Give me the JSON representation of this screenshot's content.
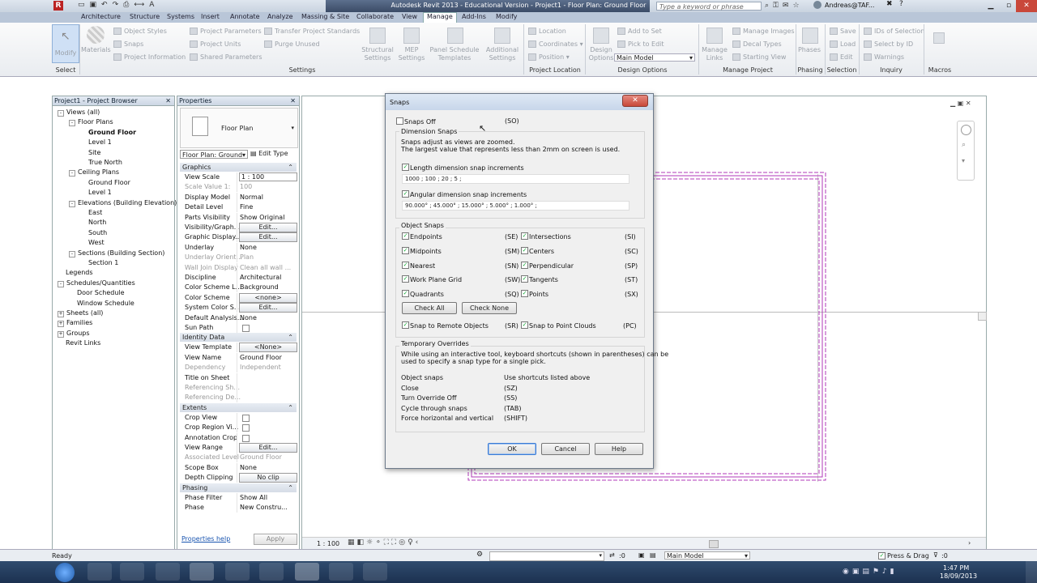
{
  "window": {
    "title": "Autodesk Revit 2013 - Educational Version  -  Project1 - Floor Plan: Ground Floor",
    "search_placeholder": "Type a keyword or phrase",
    "user": "Andreas@TAF..."
  },
  "tabs": [
    "Architecture",
    "Structure",
    "Systems",
    "Insert",
    "Annotate",
    "Analyze",
    "Massing & Site",
    "Collaborate",
    "View",
    "Manage",
    "Add-Ins",
    "Modify"
  ],
  "active_tab": "Manage",
  "ribbon": {
    "modify": "Modify",
    "materials": "Materials",
    "settings_items": [
      "Object Styles",
      "Snaps",
      "Project Information",
      "Project Parameters",
      "Project Units",
      "Shared Parameters",
      "Transfer Project Standards",
      "Purge Unused"
    ],
    "big_items": [
      "Structural Settings",
      "MEP Settings",
      "Panel Schedule Templates",
      "Additional Settings"
    ],
    "location_items": [
      "Location",
      "Coordinates",
      "Position"
    ],
    "design_options": "Design Options",
    "design_option_items": [
      "Add to Set",
      "Pick to Edit",
      "Main Model"
    ],
    "manage_links": "Manage Links",
    "manage_project_items": [
      "Manage Images",
      "Decal Types",
      "Starting View"
    ],
    "phases": "Phases",
    "selection_items": [
      "Save",
      "Load",
      "Edit"
    ],
    "inquiry_items": [
      "IDs of Selection",
      "Select by ID",
      "Warnings"
    ],
    "panel_labels": [
      "Select",
      "Settings",
      "Project Location",
      "Design Options",
      "Manage Project",
      "Phasing",
      "Selection",
      "Inquiry",
      "Macros"
    ]
  },
  "browser": {
    "title": "Project1 - Project Browser",
    "items": [
      {
        "label": "Views (all)",
        "indent": 0,
        "box": "-"
      },
      {
        "label": "Floor Plans",
        "indent": 1,
        "box": "-"
      },
      {
        "label": "Ground Floor",
        "indent": 2,
        "bold": true
      },
      {
        "label": "Level 1",
        "indent": 2
      },
      {
        "label": "Site",
        "indent": 2
      },
      {
        "label": "True North",
        "indent": 2
      },
      {
        "label": "Ceiling Plans",
        "indent": 1,
        "box": "-"
      },
      {
        "label": "Ground Floor",
        "indent": 2
      },
      {
        "label": "Level 1",
        "indent": 2
      },
      {
        "label": "Elevations (Building Elevation)",
        "indent": 1,
        "box": "-"
      },
      {
        "label": "East",
        "indent": 2
      },
      {
        "label": "North",
        "indent": 2
      },
      {
        "label": "South",
        "indent": 2
      },
      {
        "label": "West",
        "indent": 2
      },
      {
        "label": "Sections (Building Section)",
        "indent": 1,
        "box": "-"
      },
      {
        "label": "Section 1",
        "indent": 2
      },
      {
        "label": "Legends",
        "indent": 0
      },
      {
        "label": "Schedules/Quantities",
        "indent": 0,
        "box": "-"
      },
      {
        "label": "Door Schedule",
        "indent": 1
      },
      {
        "label": "Window Schedule",
        "indent": 1
      },
      {
        "label": "Sheets (all)",
        "indent": 0,
        "box": "+"
      },
      {
        "label": "Families",
        "indent": 0,
        "box": "+"
      },
      {
        "label": "Groups",
        "indent": 0,
        "box": "+"
      },
      {
        "label": "Revit Links",
        "indent": 0
      }
    ]
  },
  "properties": {
    "title": "Properties",
    "type": "Floor Plan",
    "selector": "Floor Plan: Ground",
    "edit_type": "Edit Type",
    "sections": [
      {
        "name": "Graphics",
        "rows": [
          {
            "k": "View Scale",
            "v": "1 : 100",
            "field": true
          },
          {
            "k": "Scale Value  1:",
            "v": "100",
            "dis": true
          },
          {
            "k": "Display Model",
            "v": "Normal"
          },
          {
            "k": "Detail Level",
            "v": "Fine"
          },
          {
            "k": "Parts Visibility",
            "v": "Show Original"
          },
          {
            "k": "Visibility/Graph...",
            "v": "Edit...",
            "btn": true
          },
          {
            "k": "Graphic Display...",
            "v": "Edit...",
            "btn": true
          },
          {
            "k": "Underlay",
            "v": "None"
          },
          {
            "k": "Underlay Orient...",
            "v": "Plan",
            "dis": true
          },
          {
            "k": "Wall Join Display",
            "v": "Clean all wall ...",
            "dis": true
          },
          {
            "k": "Discipline",
            "v": "Architectural"
          },
          {
            "k": "Color Scheme L...",
            "v": "Background"
          },
          {
            "k": "Color Scheme",
            "v": "<none>",
            "btn": true
          },
          {
            "k": "System Color S...",
            "v": "Edit...",
            "btn": true
          },
          {
            "k": "Default Analysis...",
            "v": "None"
          },
          {
            "k": "Sun Path",
            "v": "",
            "cb": true
          }
        ]
      },
      {
        "name": "Identity Data",
        "rows": [
          {
            "k": "View Template",
            "v": "<None>",
            "btn": true
          },
          {
            "k": "View Name",
            "v": "Ground Floor"
          },
          {
            "k": "Dependency",
            "v": "Independent",
            "dis": true
          },
          {
            "k": "Title on Sheet",
            "v": ""
          },
          {
            "k": "Referencing Sh...",
            "v": "",
            "dis": true
          },
          {
            "k": "Referencing De...",
            "v": "",
            "dis": true
          }
        ]
      },
      {
        "name": "Extents",
        "rows": [
          {
            "k": "Crop View",
            "v": "",
            "cb": true
          },
          {
            "k": "Crop Region Vi...",
            "v": "",
            "cb": true
          },
          {
            "k": "Annotation Crop",
            "v": "",
            "cb": true
          },
          {
            "k": "View Range",
            "v": "Edit...",
            "btn": true
          },
          {
            "k": "Associated Level",
            "v": "Ground Floor",
            "dis": true
          },
          {
            "k": "Scope Box",
            "v": "None"
          },
          {
            "k": "Depth Clipping",
            "v": "No clip",
            "btn": true
          }
        ]
      },
      {
        "name": "Phasing",
        "rows": [
          {
            "k": "Phase Filter",
            "v": "Show All"
          },
          {
            "k": "Phase",
            "v": "New Constru..."
          }
        ]
      }
    ],
    "help_link": "Properties help",
    "apply": "Apply"
  },
  "dialog": {
    "title": "Snaps",
    "snaps_off": "Snaps Off",
    "snaps_off_sc": "(SO)",
    "dim_header": "Dimension Snaps",
    "dim_note1": "Snaps adjust as views are zoomed.",
    "dim_note2": "The largest value that represents less than 2mm on screen is used.",
    "length_label": "Length dimension snap increments",
    "length_value": "1000 ; 100 ; 20 ; 5 ;",
    "angular_label": "Angular dimension snap increments",
    "angular_value": "90.000° ; 45.000° ; 15.000° ; 5.000° ; 1.000° ;",
    "obj_header": "Object Snaps",
    "left_snaps": [
      [
        "Endpoints",
        "(SE)"
      ],
      [
        "Midpoints",
        "(SM)"
      ],
      [
        "Nearest",
        "(SN)"
      ],
      [
        "Work Plane Grid",
        "(SW)"
      ],
      [
        "Quadrants",
        "(SQ)"
      ]
    ],
    "right_snaps": [
      [
        "Intersections",
        "(SI)"
      ],
      [
        "Centers",
        "(SC)"
      ],
      [
        "Perpendicular",
        "(SP)"
      ],
      [
        "Tangents",
        "(ST)"
      ],
      [
        "Points",
        "(SX)"
      ]
    ],
    "check_all": "Check All",
    "check_none": "Check None",
    "remote": "Snap to Remote Objects",
    "remote_sc": "(SR)",
    "cloud": "Snap to Point Clouds",
    "cloud_sc": "(PC)",
    "temp_header": "Temporary Overrides",
    "temp_note1": "While using an interactive tool, keyboard shortcuts (shown in parentheses) can be",
    "temp_note2": "used to specify a snap type for a single pick.",
    "overrides": [
      [
        "Object snaps",
        "Use shortcuts listed above"
      ],
      [
        "Close",
        "(SZ)"
      ],
      [
        "Turn Override Off",
        "(SS)"
      ],
      [
        "Cycle through snaps",
        "(TAB)"
      ],
      [
        "Force horizontal and vertical",
        "(SHIFT)"
      ]
    ],
    "ok": "OK",
    "cancel": "Cancel",
    "help": "Help"
  },
  "viewbar": {
    "scale": "1 : 100"
  },
  "status": {
    "ready": "Ready",
    "coord": ":0",
    "model": "Main Model",
    "press_drag": "Press & Drag",
    "filter": ":0"
  },
  "clock": {
    "time": "1:47 PM",
    "date": "18/09/2013"
  },
  "colors": {
    "accent": "#3b4b66",
    "wall": "#b03ab8",
    "taskbar": "#1c3150"
  }
}
